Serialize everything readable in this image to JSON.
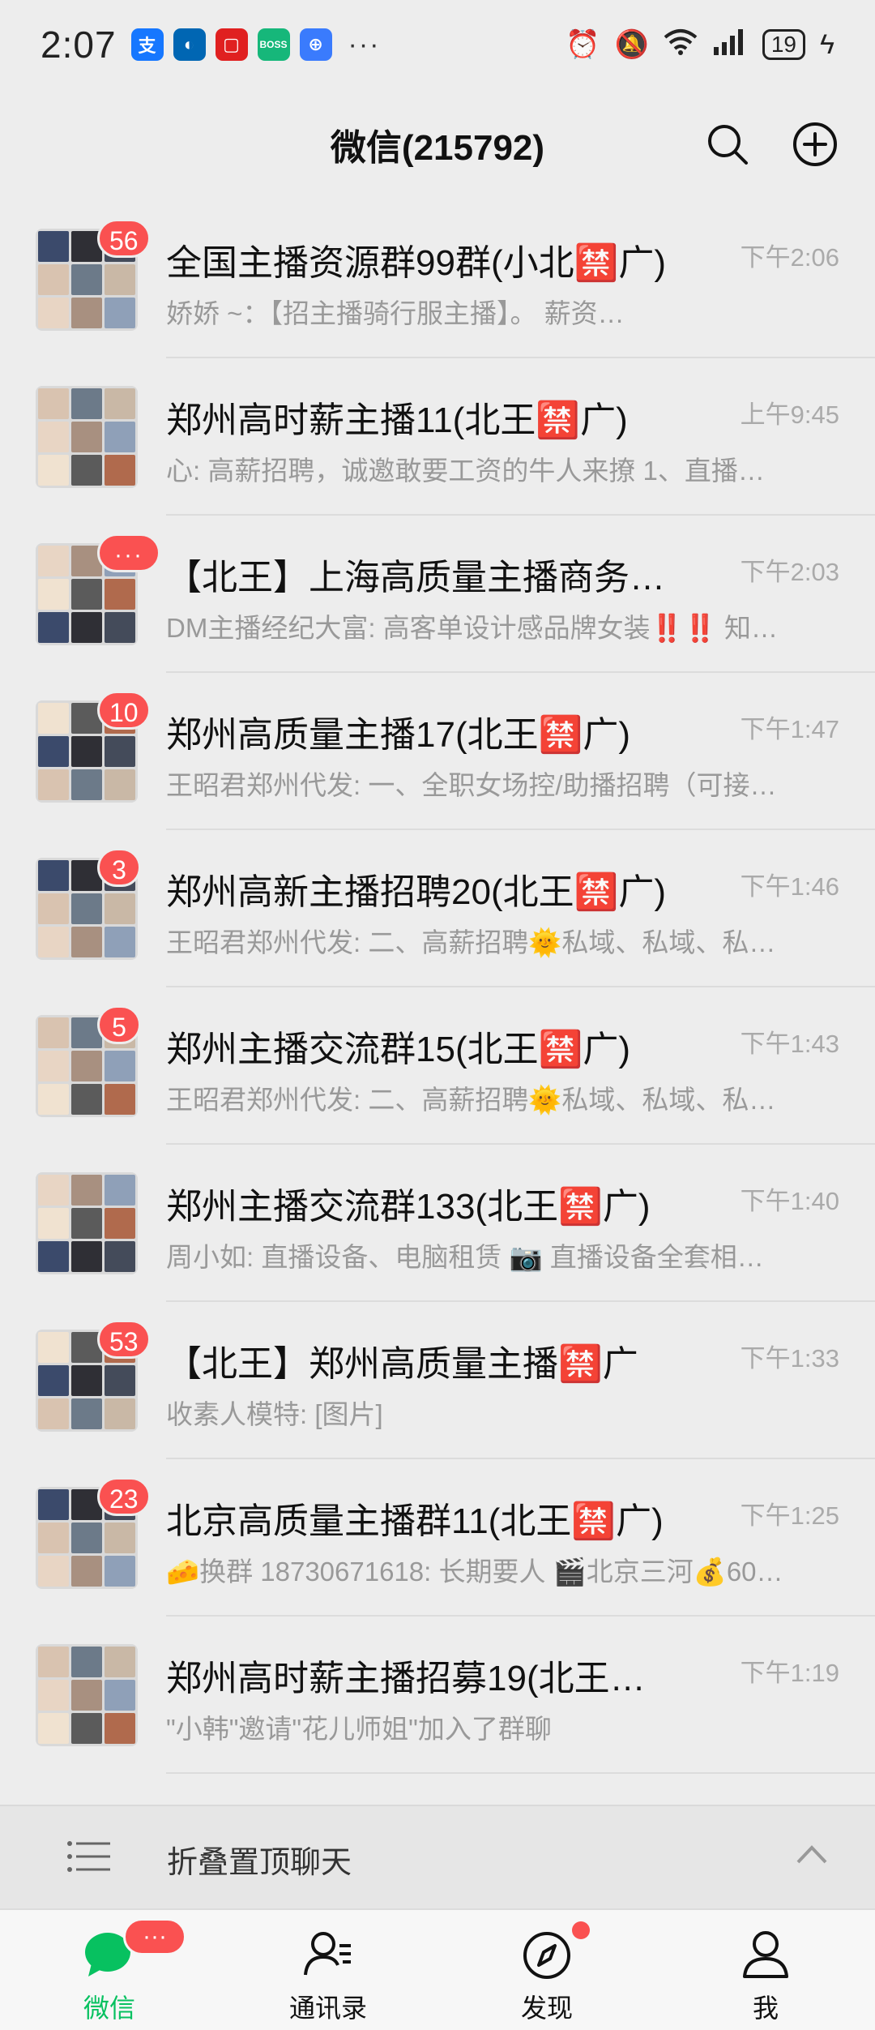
{
  "status_bar": {
    "time": "2:07",
    "apps": [
      {
        "icon": "alipay-icon",
        "glyph": "支",
        "color": "#1677ff"
      },
      {
        "icon": "ccb-icon",
        "glyph": "◐",
        "color": "#0066b3"
      },
      {
        "icon": "red-app-icon",
        "glyph": "▢",
        "color": "#e02020"
      },
      {
        "icon": "boss-zhipin-icon",
        "glyph": "BOSS",
        "color": "#16b77a"
      },
      {
        "icon": "browser-icon",
        "glyph": "⊕",
        "color": "#3a7bfd"
      }
    ],
    "more": "···",
    "battery": "19"
  },
  "header": {
    "title": "微信(215792)"
  },
  "chats": [
    {
      "title": "全国主播资源群99群(小北🈲广)",
      "time": "下午2:06",
      "preview": "娇娇 ~：【招主播骑行服主播】。             薪资…",
      "badge": "56"
    },
    {
      "title": "郑州高时薪主播11(北王🈲广)",
      "time": "上午9:45",
      "preview": "心: 高薪招聘，诚邀敢要工资的牛人来撩 1、直播…",
      "badge": ""
    },
    {
      "title": "【北王】上海高质量主播商务…",
      "time": "下午2:03",
      "preview": "DM主播经纪大富: 高客单设计感品牌女装‼️‼️ 知…",
      "badge": "···"
    },
    {
      "title": "郑州高质量主播17(北王🈲广)",
      "time": "下午1:47",
      "preview": "王昭君郑州代发: 一、全职女场控/助播招聘（可接…",
      "badge": "10"
    },
    {
      "title": "郑州高新主播招聘20(北王🈲广)",
      "time": "下午1:46",
      "preview": "王昭君郑州代发: 二、高薪招聘🌞私域、私域、私…",
      "badge": "3"
    },
    {
      "title": "郑州主播交流群15(北王🈲广)",
      "time": "下午1:43",
      "preview": "王昭君郑州代发: 二、高薪招聘🌞私域、私域、私…",
      "badge": "5"
    },
    {
      "title": "郑州主播交流群133(北王🈲广)",
      "time": "下午1:40",
      "preview": "周小如: 直播设备、电脑租赁 📷 直播设备全套相…",
      "badge": ""
    },
    {
      "title": "【北王】郑州高质量主播🈲广",
      "time": "下午1:33",
      "preview": "收素人模特: [图片]",
      "badge": "53"
    },
    {
      "title": "北京高质量主播群11(北王🈲广)",
      "time": "下午1:25",
      "preview": "🧀换群 18730671618: 长期要人 🎬北京三河💰60…",
      "badge": "23"
    },
    {
      "title": "郑州高时薪主播招募19(北王…",
      "time": "下午1:19",
      "preview": "\"小韩\"邀请\"花儿师姐\"加入了群聊",
      "badge": ""
    }
  ],
  "folded": {
    "label": "折叠置顶聊天"
  },
  "tabs": [
    {
      "label": "微信",
      "icon": "chat-bubble-icon",
      "badge": "···"
    },
    {
      "label": "通讯录",
      "icon": "contacts-icon",
      "badge": ""
    },
    {
      "label": "发现",
      "icon": "compass-icon",
      "badge": "dot"
    },
    {
      "label": "我",
      "icon": "person-icon",
      "badge": ""
    }
  ],
  "colors": {
    "accent": "#07c160",
    "badge": "#fa5151",
    "background": "#ededed"
  }
}
